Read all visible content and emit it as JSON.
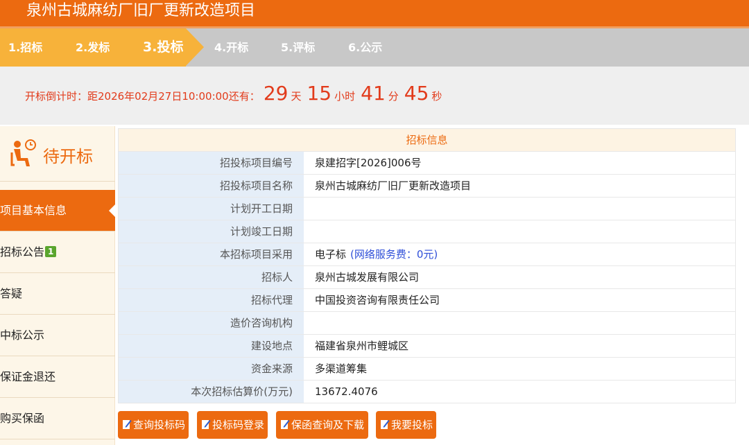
{
  "header": {
    "title": "泉州古城麻纺厂旧厂更新改造项目"
  },
  "steps": [
    {
      "label": "1.招标",
      "state": "done"
    },
    {
      "label": "2.发标",
      "state": "done"
    },
    {
      "label": "3.投标",
      "state": "active"
    },
    {
      "label": "4.开标",
      "state": "pending"
    },
    {
      "label": "5.评标",
      "state": "pending"
    },
    {
      "label": "6.公示",
      "state": "pending"
    }
  ],
  "countdown": {
    "lead": "开标倒计时：距2026年02月27日10:00:00还有：",
    "days": "29",
    "days_unit": "天",
    "hours": "15",
    "hours_unit": "小时",
    "minutes": "41",
    "minutes_unit": "分",
    "seconds": "45",
    "seconds_unit": "秒"
  },
  "sidebar": {
    "status": {
      "icon": "waiting-person-clock-icon",
      "text": "待开标"
    },
    "items": [
      {
        "label": "项目基本信息",
        "active": true
      },
      {
        "label": "招标公告",
        "badge": "1"
      },
      {
        "label": "答疑"
      },
      {
        "label": "中标公示"
      },
      {
        "label": "保证金退还"
      },
      {
        "label": "购买保函"
      }
    ]
  },
  "info": {
    "title": "招标信息",
    "rows": [
      {
        "label": "招投标项目编号",
        "value": "泉建招字[2026]006号"
      },
      {
        "label": "招投标项目名称",
        "value": "泉州古城麻纺厂旧厂更新改造项目"
      },
      {
        "label": "计划开工日期",
        "value": ""
      },
      {
        "label": "计划竣工日期",
        "value": ""
      },
      {
        "label": "本招标项目采用",
        "value": "电子标",
        "note": "(网络服务费：0元)"
      },
      {
        "label": "招标人",
        "value": "泉州古城发展有限公司"
      },
      {
        "label": "招标代理",
        "value": "中国投资咨询有限责任公司"
      },
      {
        "label": "造价咨询机构",
        "value": ""
      },
      {
        "label": "建设地点",
        "value": "福建省泉州市鲤城区"
      },
      {
        "label": "资金来源",
        "value": "多渠道筹集"
      },
      {
        "label": "本次招标估算价(万元)",
        "value": "13672.4076"
      }
    ]
  },
  "actions": [
    {
      "label": "查询投标码",
      "icon": "edit-icon"
    },
    {
      "label": "投标码登录",
      "icon": "edit-icon"
    },
    {
      "label": "保函查询及下载",
      "icon": "edit-icon"
    },
    {
      "label": "我要投标",
      "icon": "edit-icon"
    }
  ],
  "colors": {
    "brand_orange": "#ec6a10",
    "step_done": "#f7b23a",
    "countdown_red": "#e23b1b",
    "fee_blue": "#2f4fd8",
    "badge_green": "#5aa52d"
  }
}
